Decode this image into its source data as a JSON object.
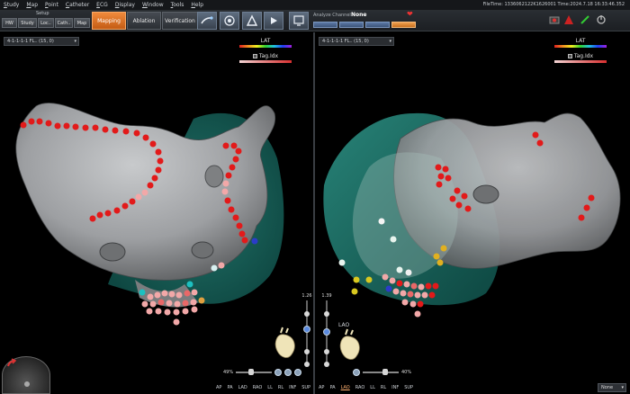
{
  "menu": {
    "items": [
      "Study",
      "Map",
      "Point",
      "Catheter",
      "ECG",
      "Display",
      "Window",
      "Tools",
      "Help"
    ],
    "file_time": "FileTime: 1336062122K1626001 Time:2024.7.18 16:33:46.352"
  },
  "toolbar": {
    "setup_title": "Setup",
    "setup_buttons": [
      "HW",
      "Study",
      "Loc..",
      "Cath..",
      "Map"
    ],
    "modes": [
      "Mapping",
      "Ablation",
      "Verification"
    ],
    "active_mode": "Mapping",
    "channel_label": "Analyze Channel",
    "channel_value": "None",
    "channel_buttons": [
      "",
      "",
      "",
      ""
    ],
    "tool_icons": [
      "catheter-tool-icon",
      "sphere-tool-icon",
      "triangle-tool-icon",
      "play-tool-icon",
      "monitor-tool-icon"
    ],
    "status_icons": [
      "record-icon",
      "alert-icon",
      "signal-icon",
      "power-icon"
    ]
  },
  "left_view": {
    "map_name": "4-1-1-1-1 FL.. (15, 0)",
    "lat_label": "LAT",
    "tag_label": "Tag.Idx",
    "zoom_value": "1.26",
    "zoom_level": 0.55,
    "percent": "49%",
    "view_label": "",
    "views": [
      "AP",
      "PA",
      "LAD",
      "RAO",
      "LL",
      "RL",
      "INF",
      "SUP"
    ],
    "active_view": ""
  },
  "right_view": {
    "map_name": "4-1-1-1-1 FL.. (15, 0)",
    "lat_label": "LAT",
    "tag_label": "Tag.Idx",
    "zoom_value": "1.39",
    "zoom_level": 0.5,
    "percent": "40%",
    "view_label": "LAO",
    "views": [
      "AP",
      "PA",
      "LAO",
      "RAO",
      "LL",
      "RL",
      "INF",
      "SUP"
    ],
    "active_view": "LAO"
  },
  "footer": {
    "display_select": "None"
  },
  "colors": {
    "anatomy": "#a9acaf",
    "tissue": "#1b6f66",
    "tag_red": "#d81818",
    "tag_pink": "#f0a8a8",
    "active_mode": "#e07a2c"
  }
}
